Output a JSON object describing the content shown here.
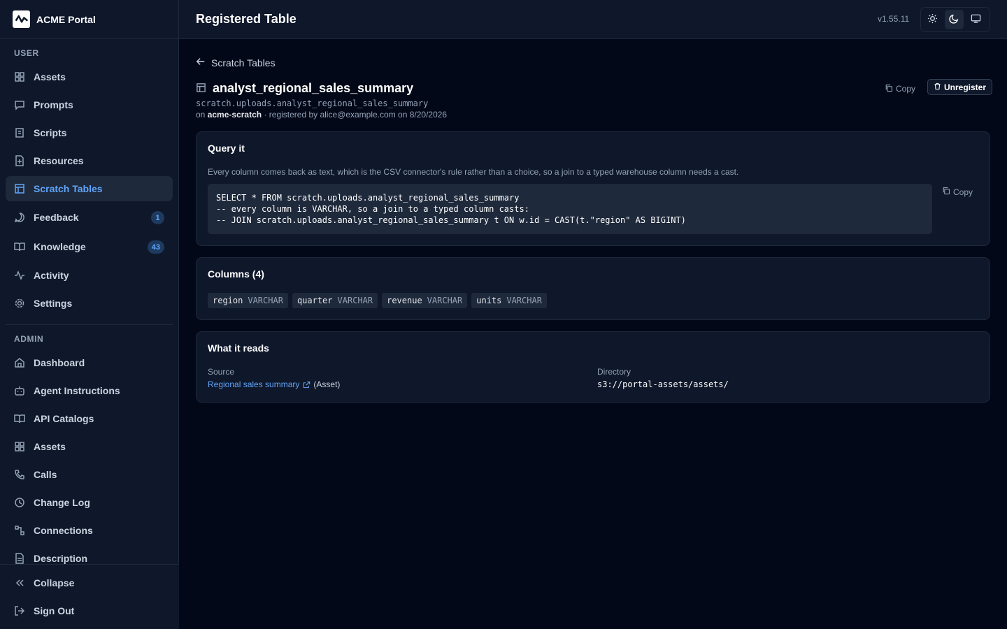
{
  "app": {
    "name": "ACME Portal",
    "version": "v1.55.11"
  },
  "header": {
    "title": "Registered Table"
  },
  "sidebar": {
    "user_label": "USER",
    "admin_label": "ADMIN",
    "user_items": [
      {
        "label": "Assets",
        "icon": "grid-icon"
      },
      {
        "label": "Prompts",
        "icon": "message-icon"
      },
      {
        "label": "Scripts",
        "icon": "code-icon"
      },
      {
        "label": "Resources",
        "icon": "file-plus-icon"
      },
      {
        "label": "Scratch Tables",
        "icon": "table-icon",
        "active": true
      },
      {
        "label": "Feedback",
        "icon": "chat-icon",
        "badge": "1"
      },
      {
        "label": "Knowledge",
        "icon": "book-icon",
        "badge": "43"
      },
      {
        "label": "Activity",
        "icon": "activity-icon"
      },
      {
        "label": "Settings",
        "icon": "gear-icon"
      }
    ],
    "admin_items": [
      {
        "label": "Dashboard",
        "icon": "home-icon"
      },
      {
        "label": "Agent Instructions",
        "icon": "bot-icon"
      },
      {
        "label": "API Catalogs",
        "icon": "book-open-icon"
      },
      {
        "label": "Assets",
        "icon": "grid-icon"
      },
      {
        "label": "Calls",
        "icon": "phone-icon"
      },
      {
        "label": "Change Log",
        "icon": "clock-icon"
      },
      {
        "label": "Connections",
        "icon": "link-icon"
      },
      {
        "label": "Description",
        "icon": "doc-icon"
      }
    ],
    "collapse_label": "Collapse",
    "signout_label": "Sign Out"
  },
  "main": {
    "back_label": "Scratch Tables",
    "table_name": "analyst_regional_sales_summary",
    "fqn": "scratch.uploads.analyst_regional_sales_summary",
    "meta_on": "on",
    "meta_connection": "acme-scratch",
    "meta_rest": "· registered by alice@example.com on 8/20/2026",
    "copy_label": "Copy",
    "unregister_label": "Unregister",
    "query": {
      "title": "Query it",
      "desc": "Every column comes back as text, which is the CSV connector's rule rather than a choice, so a join to a typed warehouse column needs a cast.",
      "code": "SELECT * FROM scratch.uploads.analyst_regional_sales_summary\n-- every column is VARCHAR, so a join to a typed column casts:\n-- JOIN scratch.uploads.analyst_regional_sales_summary t ON w.id = CAST(t.\"region\" AS BIGINT)",
      "copy_label": "Copy"
    },
    "columns": {
      "title": "Columns (4)",
      "items": [
        {
          "name": "region",
          "type": "VARCHAR"
        },
        {
          "name": "quarter",
          "type": "VARCHAR"
        },
        {
          "name": "revenue",
          "type": "VARCHAR"
        },
        {
          "name": "units",
          "type": "VARCHAR"
        }
      ]
    },
    "reads": {
      "title": "What it reads",
      "source_label": "Source",
      "source_link": "Regional sales summary",
      "source_kind": "(Asset)",
      "directory_label": "Directory",
      "directory_value": "s3://portal-assets/assets/"
    }
  },
  "colors": {
    "accent": "#60a5fa",
    "background": "#020817",
    "surface": "#0f172a"
  }
}
